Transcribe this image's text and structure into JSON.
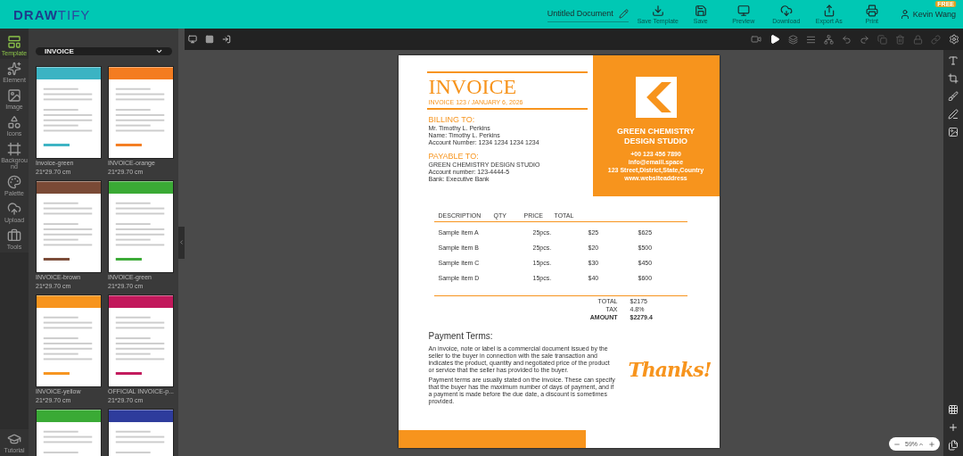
{
  "header": {
    "logo": {
      "first": "DRAW",
      "second": "TIFY"
    },
    "document_title": "Untitled Document",
    "actions": [
      {
        "kind": "save-template",
        "label": "Save Template"
      },
      {
        "kind": "save",
        "label": "Save"
      },
      {
        "kind": "preview",
        "label": "Preview"
      },
      {
        "kind": "download",
        "label": "Download"
      },
      {
        "kind": "export",
        "label": "Export As"
      },
      {
        "kind": "print",
        "label": "Print"
      }
    ],
    "user": {
      "name": "Kevin Wang",
      "badge": "FREE"
    }
  },
  "rail": [
    {
      "kind": "template",
      "label": "Template",
      "selected": true
    },
    {
      "kind": "element",
      "label": "Element",
      "selected": false
    },
    {
      "kind": "image",
      "label": "Image",
      "selected": false
    },
    {
      "kind": "icons",
      "label": "Icons",
      "selected": false
    },
    {
      "kind": "background",
      "label": "Background",
      "selected": false
    },
    {
      "kind": "palette",
      "label": "Palette",
      "selected": false
    },
    {
      "kind": "upload",
      "label": "Upload",
      "selected": false
    },
    {
      "kind": "tools",
      "label": "Tools",
      "selected": false
    }
  ],
  "rail_bottom": {
    "label": "Tutorial"
  },
  "panel": {
    "category": "INVOICE",
    "templates": [
      {
        "name": "Invoice-green",
        "size": "21*29.70 cm",
        "color": "#3bb3c3"
      },
      {
        "name": "INVOICE-orange",
        "size": "21*29.70 cm",
        "color": "#f47c20"
      },
      {
        "name": "INVOICE-brown",
        "size": "21*29.70 cm",
        "color": "#7a4a36"
      },
      {
        "name": "INVOICE-green",
        "size": "21*29.70 cm",
        "color": "#3aaa35"
      },
      {
        "name": "INVOICE-yellow",
        "size": "21*29.70 cm",
        "color": "#f7941d"
      },
      {
        "name": "OFFICIAL INVOICE-p...",
        "size": "21*29.70 cm",
        "color": "#c2185b"
      },
      {
        "color": "#3aaa35"
      },
      {
        "color": "#2e3c9c"
      }
    ]
  },
  "document": {
    "title": "INVOICE",
    "subtitle": "INVOICE 123 / JANUARY 6, 2026",
    "billing": {
      "heading": "BILLING TO:",
      "name": "Mr. Timothy L. Perkins",
      "lines": [
        "Name: Timothy L. Perkins",
        "Account Number: 1234 1234 1234 1234"
      ]
    },
    "payable": {
      "heading": "PAYABLE TO:",
      "name": "GREEN CHEMISTRY DESIGN STUDIO",
      "lines": [
        "Account number: 123-4444-5",
        "Bank: Executive Bank"
      ]
    },
    "company": {
      "name": "GREEN CHEMISTRY DESIGN STUDIO",
      "contacts": [
        "+00 123 456 7890",
        "info@emaill.space",
        "123 Street,District,State,Country",
        "www.websiteaddress"
      ]
    },
    "columns": [
      "DESCRIPTION",
      "QTY",
      "PRICE",
      "TOTAL"
    ],
    "rows": [
      [
        "Sample item A",
        "25pcs.",
        "$25",
        "$625"
      ],
      [
        "Sample item B",
        "25pcs.",
        "$20",
        "$500"
      ],
      [
        "Sample item C",
        "15pcs.",
        "$30",
        "$450"
      ],
      [
        "Sample item D",
        "15pcs.",
        "$40",
        "$600"
      ]
    ],
    "totals": [
      {
        "label": "TOTAL",
        "value": "$2175",
        "bold": false
      },
      {
        "label": "TAX",
        "value": "4.8%",
        "bold": false
      },
      {
        "label": "AMOUNT",
        "value": "$2279.4",
        "bold": true
      }
    ],
    "terms_heading": "Payment Terms:",
    "terms": [
      "An invoice, note or label is a commercial document issued by the seller to the buyer in connection with the sale transaction and indicates the product, quantity and negotiated price of the product or service that the seller has provided to the buyer.",
      "Payment terms are usually stated on the invoice. These can specify that the buyer has the maximum number of days of payment, and if a payment is made before the due date, a discount is sometimes provided."
    ],
    "thanks": "Thanks!"
  },
  "zoom": {
    "value": "59%"
  }
}
